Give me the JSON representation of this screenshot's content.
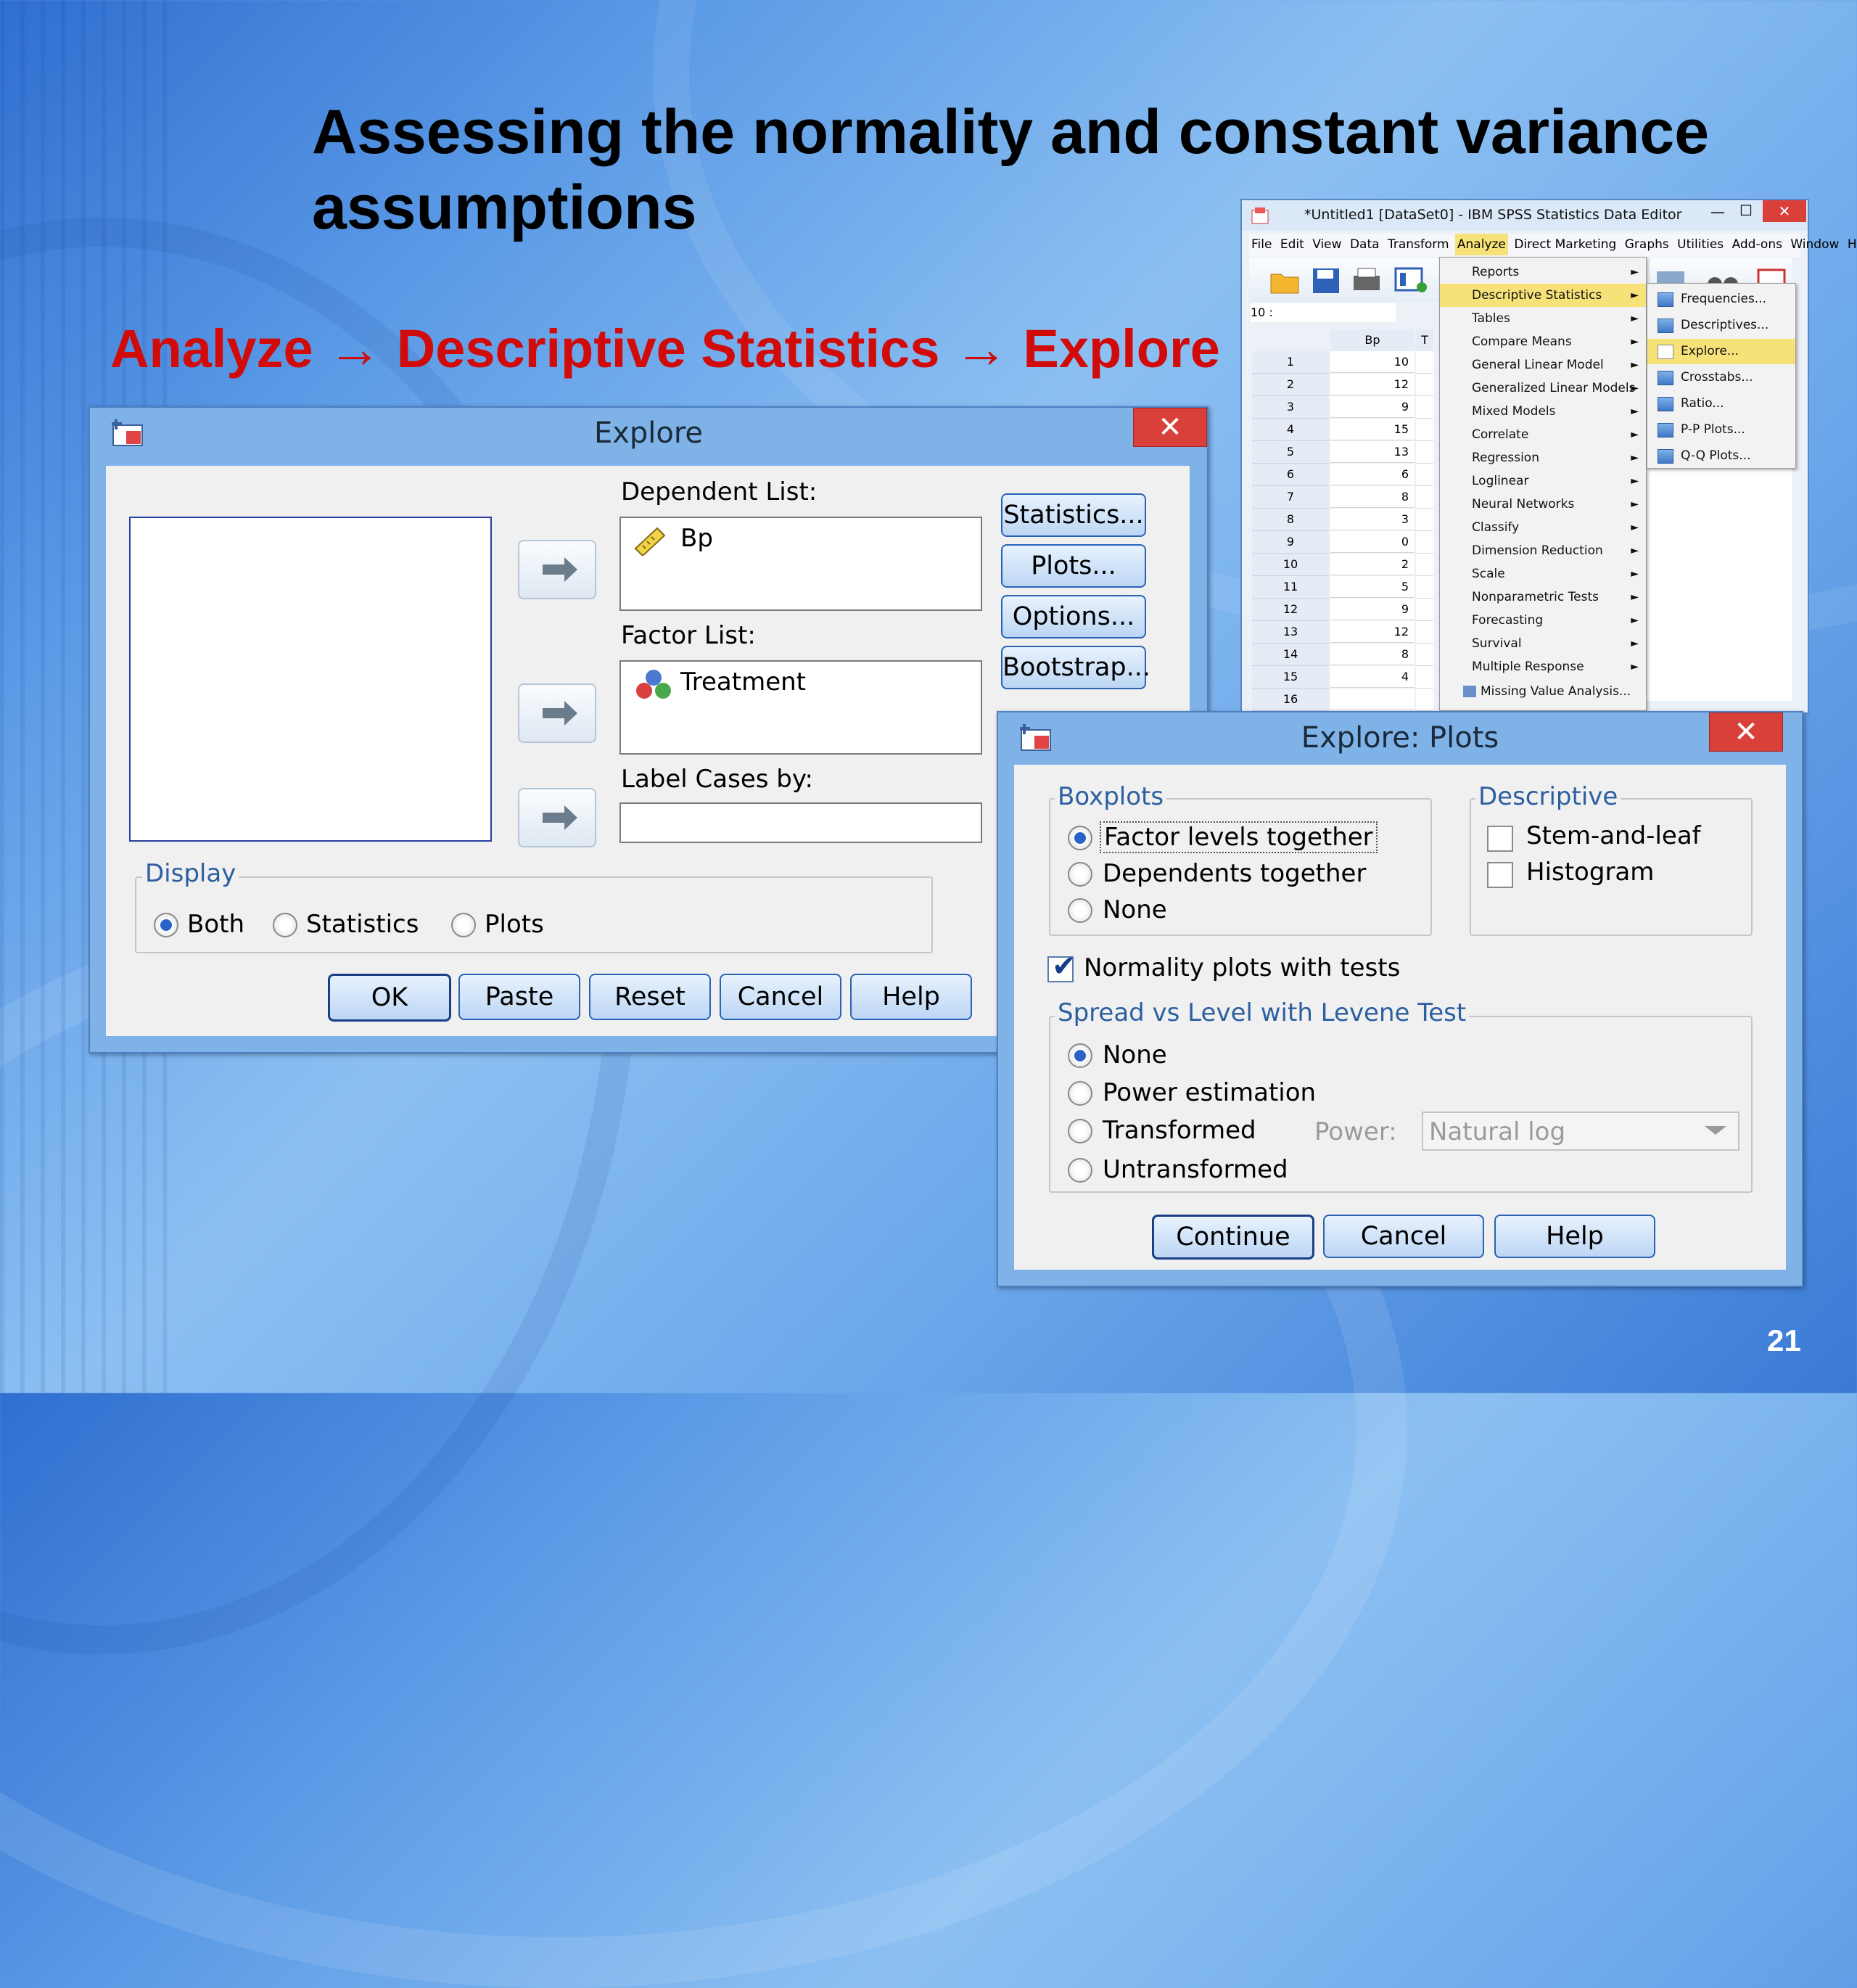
{
  "slide": {
    "title": "Assessing the normality and constant variance assumptions",
    "menu_path": "Analyze → Descriptive Statistics → Explore",
    "page_number": "21",
    "accent_color": "#d10a0a"
  },
  "spss": {
    "window_title": "*Untitled1 [DataSet0] - IBM SPSS Statistics Data Editor",
    "menubar": [
      "File",
      "Edit",
      "View",
      "Data",
      "Transform",
      "Analyze",
      "Direct Marketing",
      "Graphs",
      "Utilities",
      "Add-ons",
      "Window",
      "Help"
    ],
    "cell_ref": "10 :",
    "column_header": "Bp",
    "column_header_2": "T",
    "rows": [
      {
        "n": "1",
        "v": "10"
      },
      {
        "n": "2",
        "v": "12"
      },
      {
        "n": "3",
        "v": "9"
      },
      {
        "n": "4",
        "v": "15"
      },
      {
        "n": "5",
        "v": "13"
      },
      {
        "n": "6",
        "v": "6"
      },
      {
        "n": "7",
        "v": "8"
      },
      {
        "n": "8",
        "v": "3"
      },
      {
        "n": "9",
        "v": "0"
      },
      {
        "n": "10",
        "v": "2"
      },
      {
        "n": "11",
        "v": "5"
      },
      {
        "n": "12",
        "v": "9"
      },
      {
        "n": "13",
        "v": "12"
      },
      {
        "n": "14",
        "v": "8"
      },
      {
        "n": "15",
        "v": "4"
      },
      {
        "n": "16",
        "v": ""
      }
    ],
    "analyze_menu": [
      "Reports",
      "Descriptive Statistics",
      "Tables",
      "Compare Means",
      "General Linear Model",
      "Generalized Linear Models",
      "Mixed Models",
      "Correlate",
      "Regression",
      "Loglinear",
      "Neural Networks",
      "Classify",
      "Dimension Reduction",
      "Scale",
      "Nonparametric Tests",
      "Forecasting",
      "Survival",
      "Multiple Response",
      "Missing Value Analysis..."
    ],
    "descriptives_submenu": [
      "Frequencies...",
      "Descriptives...",
      "Explore...",
      "Crosstabs...",
      "Ratio...",
      "P-P Plots...",
      "Q-Q Plots..."
    ]
  },
  "explore": {
    "title": "Explore",
    "close": "✕",
    "dependent_list_label": "Dependent List:",
    "dependent_item": "Bp",
    "factor_list_label": "Factor List:",
    "factor_item": "Treatment",
    "label_cases_label": "Label Cases by:",
    "side_buttons": [
      "Statistics...",
      "Plots...",
      "Options...",
      "Bootstrap..."
    ],
    "display_group": "Display",
    "display_options": [
      "Both",
      "Statistics",
      "Plots"
    ],
    "bottom_buttons": [
      "OK",
      "Paste",
      "Reset",
      "Cancel",
      "Help"
    ]
  },
  "plots": {
    "title": "Explore: Plots",
    "close": "✕",
    "boxplots_group": "Boxplots",
    "boxplot_options": [
      "Factor levels together",
      "Dependents together",
      "None"
    ],
    "descriptive_group": "Descriptive",
    "descriptive_options": [
      "Stem-and-leaf",
      "Histogram"
    ],
    "normality": "Normality plots with tests",
    "spread_group": "Spread vs Level with Levene Test",
    "spread_options": [
      "None",
      "Power estimation",
      "Transformed",
      "Untransformed"
    ],
    "power_label": "Power:",
    "power_value": "Natural log",
    "buttons": [
      "Continue",
      "Cancel",
      "Help"
    ]
  }
}
